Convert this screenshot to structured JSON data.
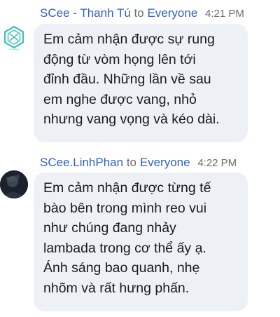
{
  "messages": [
    {
      "sender": "SCee - Thanh Tú",
      "to_word": "to",
      "recipient": "Everyone",
      "time": "4:21 PM",
      "avatar_icon": "hexagon-logo-icon",
      "text": "Em cảm nhận được sự rung\nđộng từ vòm họng lên tới\nđỉnh đầu. Những lần về sau\nem nghe được vang, nhỏ\nnhưng vang vọng và kéo dài."
    },
    {
      "sender": "SCee.LinhPhan",
      "to_word": "to",
      "recipient": "Everyone",
      "time": "4:22 PM",
      "avatar_icon": "user-photo-icon",
      "text": "Em cảm nhận được từng tế\nbào bên trong mình reo vui\nnhư chúng đang nhảy\nlambada trong cơ thể ấy ạ.\nÁnh sáng bao quanh, nhẹ\nnhõm và rất hưng phấn."
    }
  ],
  "colors": {
    "name": "#2d63c8",
    "muted": "#6b6b6b",
    "bubble": "#edf1f5",
    "text": "#1a1a1a"
  }
}
